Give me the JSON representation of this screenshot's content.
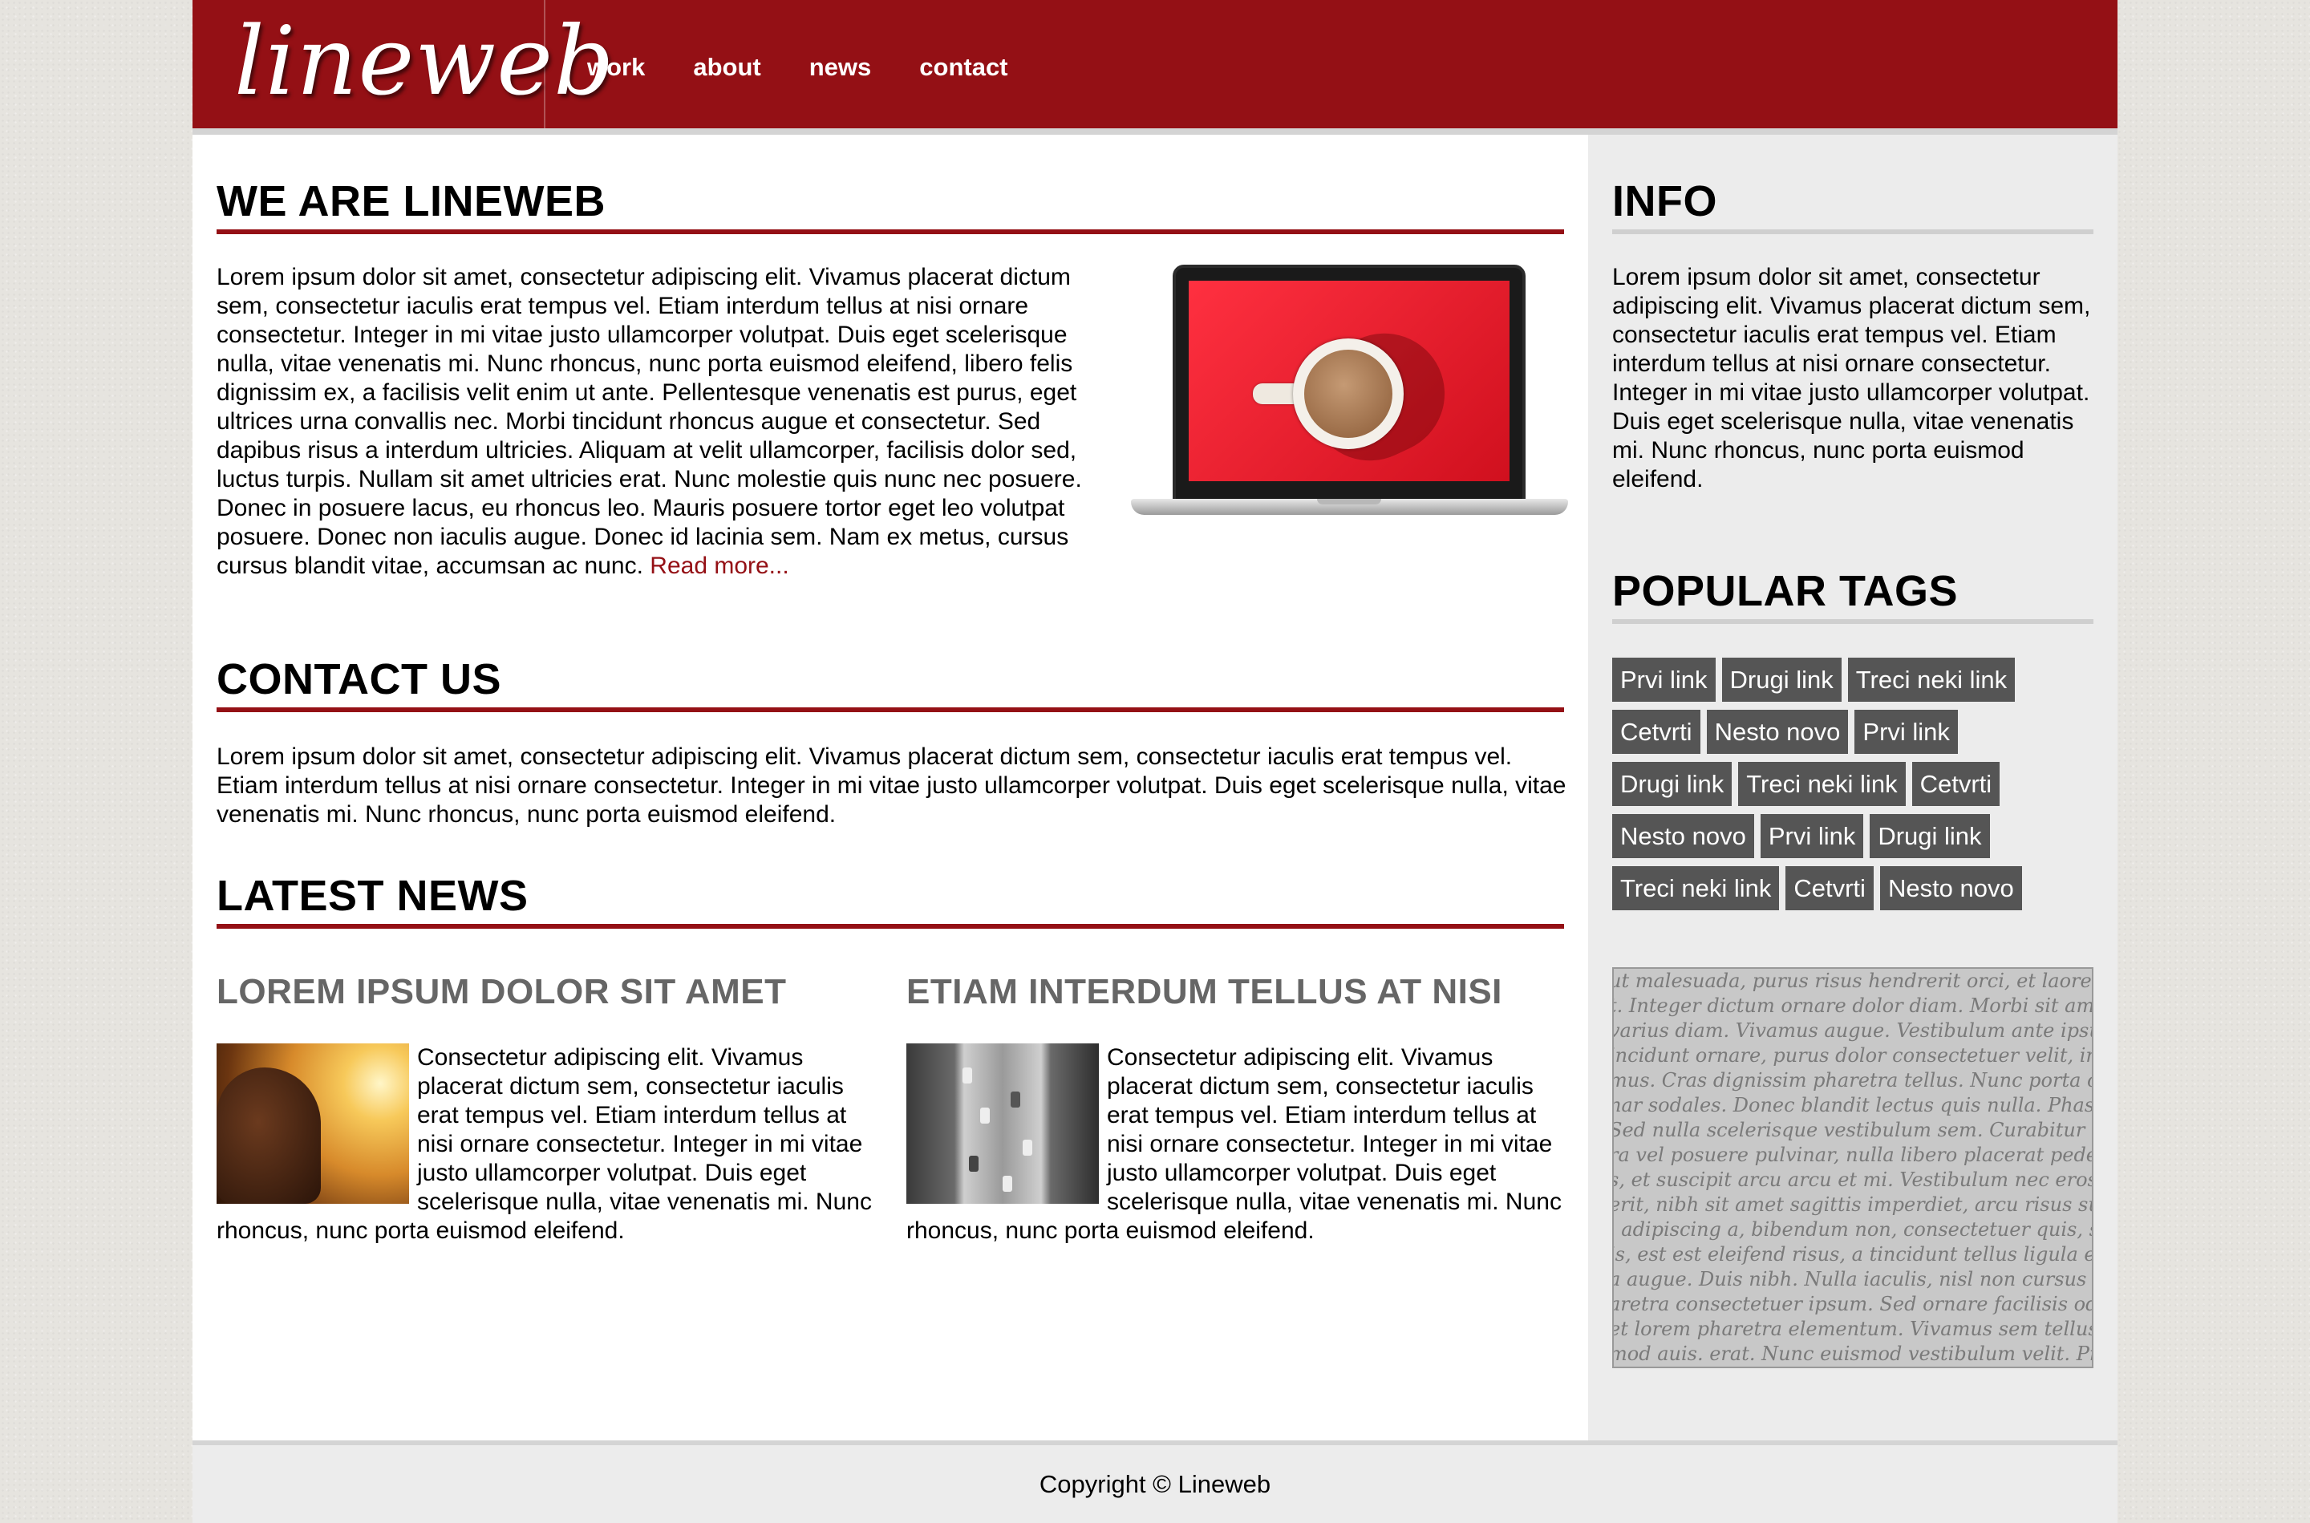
{
  "brand": {
    "logo": "lineweb",
    "accent_color": "#941015"
  },
  "nav": [
    {
      "label": "work"
    },
    {
      "label": "about"
    },
    {
      "label": "news"
    },
    {
      "label": "contact"
    }
  ],
  "about": {
    "title": "WE ARE LINEWEB",
    "body": "Lorem ipsum dolor sit amet, consectetur adipiscing elit. Vivamus placerat dictum sem, consectetur iaculis erat tempus vel. Etiam interdum tellus at nisi ornare consectetur. Integer in mi vitae justo ullamcorper volutpat. Duis eget scelerisque nulla, vitae venenatis mi. Nunc rhoncus, nunc porta euismod eleifend, libero felis dignissim ex, a facilisis velit enim ut ante. Pellentesque venenatis est purus, eget ultrices urna convallis nec. Morbi tincidunt rhoncus augue et consectetur. Sed dapibus risus a interdum ultricies. Aliquam at velit ullamcorper, facilisis dolor sed, luctus turpis. Nullam sit amet ultricies erat. Nunc molestie quis nunc nec posuere. Donec in posuere lacus, eu rhoncus leo. Mauris posuere tortor eget leo volutpat posuere. Donec non iaculis augue. Donec id lacinia sem. Nam ex metus, cursus cursus blandit vitae, accumsan ac nunc. ",
    "read_more": "Read more..."
  },
  "contact": {
    "title": "CONTACT US",
    "body": "Lorem ipsum dolor sit amet, consectetur adipiscing elit. Vivamus placerat dictum sem, consectetur iaculis erat tempus vel. Etiam interdum tellus at nisi ornare consectetur. Integer in mi vitae justo ullamcorper volutpat. Duis eget scelerisque nulla, vitae venenatis mi. Nunc rhoncus, nunc porta euismod eleifend."
  },
  "news": {
    "title": "LATEST NEWS",
    "items": [
      {
        "title": "LOREM IPSUM DOLOR SIT AMET",
        "body": "Consectetur adipiscing elit. Vivamus placerat dictum sem, consectetur iaculis erat tempus vel. Etiam interdum tellus at nisi ornare consectetur. Integer in mi vitae justo ullamcorper volutpat. Duis eget scelerisque nulla, vitae venenatis mi. Nunc rhoncus, nunc porta euismod eleifend."
      },
      {
        "title": "ETIAM INTERDUM TELLUS AT NISI",
        "body": "Consectetur adipiscing elit. Vivamus placerat dictum sem, consectetur iaculis erat tempus vel. Etiam interdum tellus at nisi ornare consectetur. Integer in mi vitae justo ullamcorper volutpat. Duis eget scelerisque nulla, vitae venenatis mi. Nunc rhoncus, nunc porta euismod eleifend."
      }
    ]
  },
  "sidebar": {
    "info_title": "INFO",
    "info_body": "Lorem ipsum dolor sit amet, consectetur adipiscing elit. Vivamus placerat dictum sem, consectetur iaculis erat tempus vel. Etiam interdum tellus at nisi ornare consectetur. Integer in mi vitae justo ullamcorper volutpat. Duis eget scelerisque nulla, vitae venenatis mi. Nunc rhoncus, nunc porta euismod eleifend.",
    "tags_title": "POPULAR TAGS",
    "tag_rows": [
      [
        "Prvi link",
        "Drugi link",
        "Treci neki link"
      ],
      [
        "Cetvrti",
        "Nesto novo",
        "Prvi link"
      ],
      [
        "Drugi link",
        "Treci neki link",
        "Cetvrti"
      ],
      [
        "Nesto novo",
        "Prvi link",
        "Drugi link"
      ],
      [
        "Treci neki link",
        "Cetvrti",
        "Nesto novo"
      ]
    ],
    "script_lines": [
      "ut malesuada, purus risus hendrerit orci, et laoreet pede enim",
      "t. Integer dictum ornare dolor diam. Morbi sit amet arcu rutrum",
      "varius diam. Vivamus augue. Vestibulum ante ipsum pede",
      "incidunt ornare, purus dolor consectetuer velit, in euismod",
      "mus. Cras dignissim pharetra tellus. Nunc porta commodo",
      "nar sodales. Donec blandit lectus quis nulla. Phasellus dui",
      "Sed nulla scelerisque vestibulum sem. Curabitur libero m",
      "ra vel posuere pulvinar, nulla libero placerat pede, at cons",
      "s, et suscipit arcu arcu et mi. Vestibulum nec eros dictum",
      "erit, nibh sit amet sagittis imperdiet, arcu risus suscipit a",
      ", adipiscing a, bibendum non, consectetuer quis, sem. Proin",
      "is, est est eleifend risus, a tincidunt tellus ligula et lectus.",
      "a augue. Duis nibh. Nulla iaculis, nisl non cursus iaculis, p",
      "aretra consectetuer ipsum. Sed ornare facilisis odio. Cum s",
      "et lorem pharetra elementum. Vivamus sem tellus, dignissi",
      "mod auis. erat. Nunc euismod vestibulum velit. Proin uri"
    ]
  },
  "footer": {
    "copyright": "Copyright © Lineweb"
  }
}
